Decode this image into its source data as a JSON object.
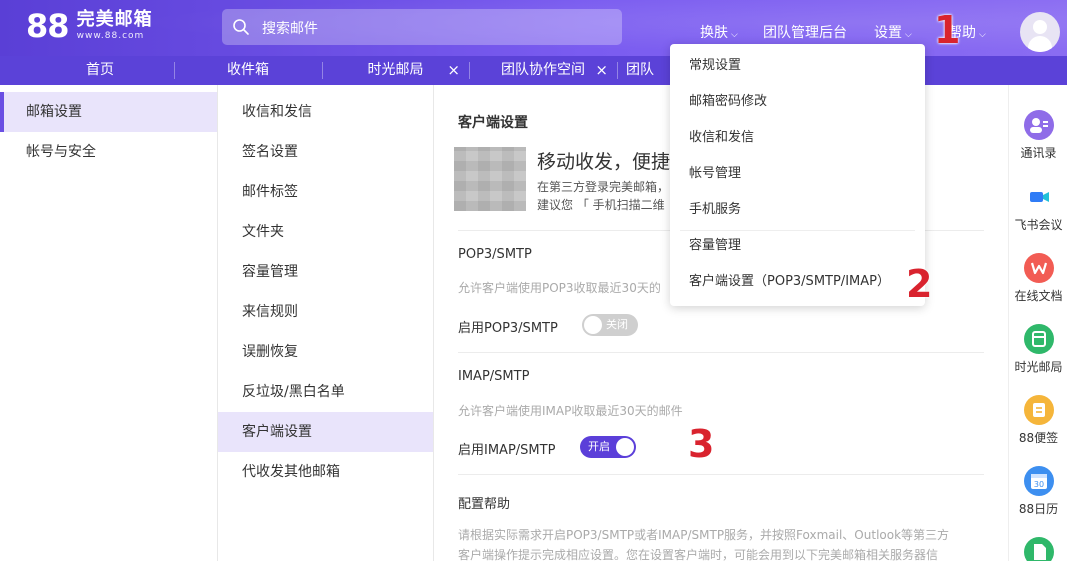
{
  "header": {
    "logo_big": "88",
    "logo_name": "完美邮箱",
    "logo_url": "www.88.com",
    "search_placeholder": "搜索邮件",
    "nav": {
      "skin": "换肤",
      "team_admin": "团队管理后台",
      "settings": "设置",
      "help": "帮助"
    }
  },
  "tabs": [
    {
      "label": "首页"
    },
    {
      "label": "收件箱"
    },
    {
      "label": "时光邮局",
      "closable": true
    },
    {
      "label": "团队协作空间",
      "closable": true
    },
    {
      "label": "团队"
    }
  ],
  "tab_close_glyph": "×",
  "left_nav": [
    {
      "label": "邮箱设置",
      "active": true
    },
    {
      "label": "帐号与安全",
      "active": false
    }
  ],
  "middle_nav": [
    {
      "label": "收信和发信"
    },
    {
      "label": "签名设置"
    },
    {
      "label": "邮件标签"
    },
    {
      "label": "文件夹"
    },
    {
      "label": "容量管理"
    },
    {
      "label": "来信规则"
    },
    {
      "label": "误删恢复"
    },
    {
      "label": "反垃圾/黑白名单"
    },
    {
      "label": "客户端设置",
      "active": true
    },
    {
      "label": "代收发其他邮箱"
    }
  ],
  "content": {
    "title": "客户端设置",
    "promo_title": "移动收发，便捷高",
    "promo_line1": "在第三方登录完美邮箱，",
    "promo_line2": "建议您 「 手机扫描二维",
    "pop3": {
      "title": "POP3/SMTP",
      "desc": "允许客户端使用POP3收取最近30天的",
      "label": "启用POP3/SMTP",
      "toggle_text": "关闭",
      "enabled": false
    },
    "imap": {
      "title": "IMAP/SMTP",
      "desc": "允许客户端使用IMAP收取最近30天的邮件",
      "label": "启用IMAP/SMTP",
      "toggle_text": "开启",
      "enabled": true
    },
    "help": {
      "title": "配置帮助",
      "line1": "请根据实际需求开启POP3/SMTP或者IMAP/SMTP服务，并按照Foxmail、Outlook等第三方",
      "line2": "客户端操作提示完成相应设置。您在设置客户端时，可能会用到以下完美邮箱相关服务器信"
    }
  },
  "settings_menu": [
    {
      "label": "常规设置"
    },
    {
      "label": "邮箱密码修改"
    },
    {
      "label": "收信和发信"
    },
    {
      "label": "帐号管理"
    },
    {
      "label": "手机服务"
    },
    {
      "label": "容量管理"
    },
    {
      "label": "客户端设置（POP3/SMTP/IMAP）"
    }
  ],
  "right_rail": [
    {
      "label": "通讯录",
      "icon": "contacts-icon",
      "color": "#8f6ce8"
    },
    {
      "label": "飞书会议",
      "icon": "video-meeting-icon",
      "color": "#2f7cf6"
    },
    {
      "label": "在线文档",
      "icon": "online-doc-icon",
      "color": "#f25c54"
    },
    {
      "label": "时光邮局",
      "icon": "time-post-icon",
      "color": "#2fb86a"
    },
    {
      "label": "88便签",
      "icon": "sticky-note-icon",
      "color": "#f5b53a"
    },
    {
      "label": "88日历",
      "icon": "calendar-icon",
      "color": "#3d8ff0"
    },
    {
      "label": "",
      "icon": "file-icon",
      "color": "#2fb86a"
    }
  ],
  "calendar_day": "30",
  "annotations": [
    "1",
    "2",
    "3"
  ],
  "colors": {
    "brand": "#6a4fe3",
    "active_bg": "#e9e4fb",
    "annotation": "#d9232e"
  }
}
